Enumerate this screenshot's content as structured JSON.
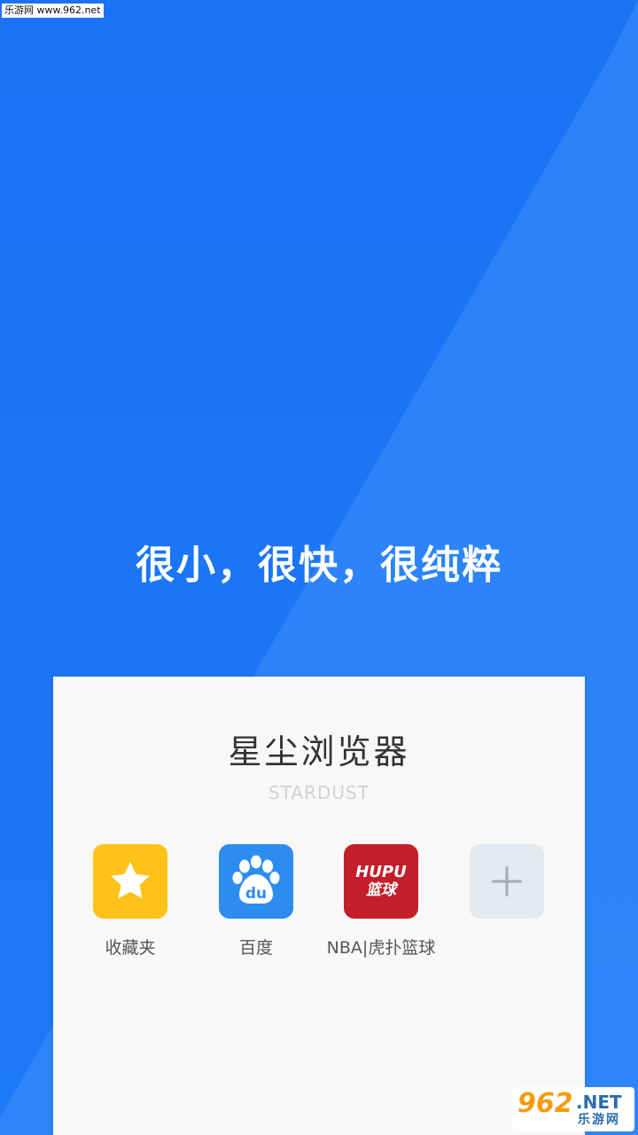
{
  "watermark_top": "乐游网 www.962.net",
  "slogan": "很小，很快，很纯粹",
  "app": {
    "name": "星尘浏览器",
    "subtitle": "STARDUST"
  },
  "shortcuts": [
    {
      "label": "收藏夹",
      "icon": "star-icon",
      "color": "#ffc21a"
    },
    {
      "label": "百度",
      "icon": "baidu-paw-icon",
      "color": "#2d8cf0",
      "icon_text": "du"
    },
    {
      "label": "NBA|虎扑篮球",
      "icon": "hupu-logo-icon",
      "color": "#c41e2a",
      "icon_text_top": "HUPU",
      "icon_text_bottom": "篮球"
    },
    {
      "label": "",
      "icon": "plus-icon",
      "color": "#e5e9f0"
    }
  ],
  "watermark_bottom": {
    "logo": "962",
    "suffix": ".NET",
    "cn": "乐游网"
  },
  "colors": {
    "background": "#1a72f5",
    "accent_light": "#3d8ffa",
    "card": "#f8f8f8"
  }
}
